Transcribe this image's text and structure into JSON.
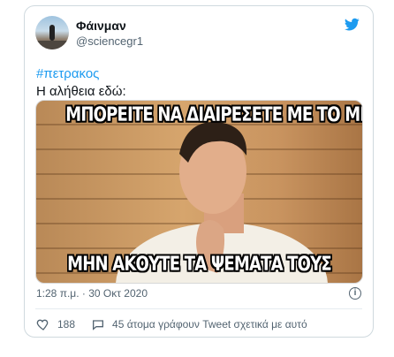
{
  "tweet": {
    "author_name": "Φάινμαν",
    "author_handle": "@sciencegr1",
    "hashtag": "#πετρακος",
    "text": "Η αλήθεια εδώ:",
    "meme": {
      "top_caption": "ΜΠΟΡΕΙΤΕ ΝΑ ΔΙΑΙΡΕΣΕΤΕ ΜΕ ΤΟ ΜΗΔΕΝ",
      "bottom_caption": "ΜΗΝ ΑΚΟΥΤΕ ΤΑ ΨΕΜΑΤΑ ΤΟΥΣ"
    },
    "timestamp": "1:28 π.μ. · 30 Οκτ 2020",
    "info_label": "i",
    "likes_count": "188",
    "reply_text": "45 άτομα γράφουν Tweet σχετικά με αυτό"
  },
  "colors": {
    "twitter_blue": "#1d9bf0",
    "muted_text": "#536471",
    "border": "#cfd9de"
  },
  "icons": [
    "twitter-bird-icon",
    "info-icon",
    "heart-icon",
    "comment-icon"
  ]
}
